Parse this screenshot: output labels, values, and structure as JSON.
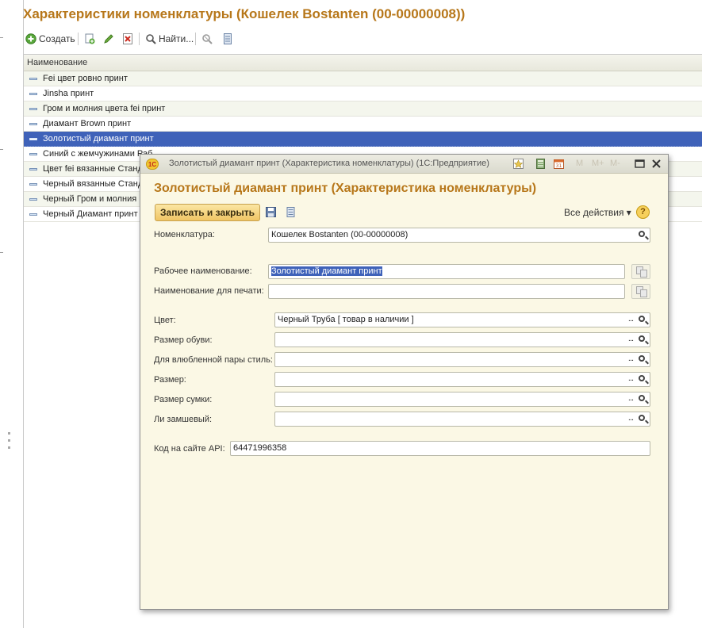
{
  "page": {
    "title": "Характеристики номенклатуры (Кошелек Bostanten (00-00000008))"
  },
  "toolbar": {
    "create_label": "Создать",
    "find_label": "Найти..."
  },
  "list": {
    "column_header": "Наименование",
    "rows": [
      "Fei цвет ровно принт",
      "Jinsha принт",
      "Гром и молния цвета fei принт",
      "Диамант Brown принт",
      "Золотистый диамант принт",
      "Синий с жемчужинами Раб",
      "Цвет fei вязанные Станд",
      "Черный вязанные Станд",
      "Черный Гром и молния",
      "Черный Диамант принт"
    ],
    "selected_index": 4
  },
  "dialog": {
    "window_title": "Золотистый диамант принт (Характеристика номенклатуры)  (1С:Предприятие)",
    "title_buttons": [
      "M",
      "M+",
      "M-"
    ],
    "logo_text": "1С",
    "heading": "Золотистый диамант принт (Характеристика номенклатуры)",
    "save_close_label": "Записать и закрыть",
    "all_actions_label": "Все действия ▾",
    "help_label": "?",
    "fields": {
      "nomenclature": {
        "label": "Номенклатура:",
        "value": "Кошелек Bostanten (00-00000008)"
      },
      "work_name": {
        "label": "Рабочее наименование:",
        "value": "Золотистый диамант принт"
      },
      "print_name": {
        "label": "Наименование для печати:",
        "value": ""
      },
      "color": {
        "label": "Цвет:",
        "value": "Черный Труба [ товар в наличии ]"
      },
      "shoe_size": {
        "label": "Размер обуви:",
        "value": ""
      },
      "couple_style": {
        "label": "Для влюбленной пары стиль:",
        "value": ""
      },
      "size": {
        "label": "Размер:",
        "value": ""
      },
      "bag_size": {
        "label": "Размер сумки:",
        "value": ""
      },
      "suede": {
        "label": "Ли замшевый:",
        "value": ""
      },
      "api_code": {
        "label": "Код на сайте API:",
        "value": "64471996358"
      }
    }
  },
  "colors": {
    "title": "#b7771a",
    "selection": "#3f62b9",
    "dialog_bg": "#fbf8e5",
    "primary_button": "#f0c564"
  }
}
